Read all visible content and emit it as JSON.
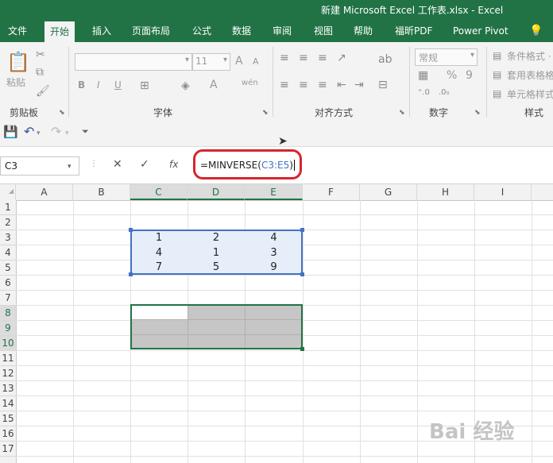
{
  "window": {
    "title": "新建 Microsoft Excel 工作表.xlsx  -  Excel"
  },
  "ribbon": {
    "tabs": [
      "文件",
      "开始",
      "插入",
      "页面布局",
      "公式",
      "数据",
      "审阅",
      "视图",
      "帮助",
      "福昕PDF",
      "Power Pivot"
    ],
    "active_tab": "开始",
    "groups": {
      "clipboard": {
        "label": "剪贴板",
        "paste_label": "粘贴"
      },
      "font": {
        "label": "字体",
        "font_size": "11",
        "bold": "B",
        "italic": "I",
        "underline": "U",
        "grow": "A",
        "shrink": "A",
        "font_color": "A",
        "wen": "wén"
      },
      "alignment": {
        "label": "对齐方式"
      },
      "number": {
        "label": "数字",
        "format": "常规",
        "percent": "%",
        "comma": "9"
      },
      "styles": {
        "label": "样式",
        "items": [
          "条件格式 ·",
          "套用表格格",
          "单元格样式"
        ]
      }
    }
  },
  "formula_bar": {
    "name_box": "C3",
    "cancel": "✕",
    "enter": "✓",
    "fx": "fx",
    "formula_prefix": "=MINVERSE(",
    "formula_ref": "C3:E5",
    "formula_suffix": ")"
  },
  "grid": {
    "columns": [
      "A",
      "B",
      "C",
      "D",
      "E",
      "F",
      "G",
      "H",
      "I"
    ],
    "rows": [
      "1",
      "2",
      "3",
      "4",
      "5",
      "6",
      "7",
      "8",
      "9",
      "10",
      "11",
      "12",
      "13",
      "14",
      "15",
      "16",
      "17"
    ],
    "matrix": [
      [
        "1",
        "2",
        "4"
      ],
      [
        "4",
        "1",
        "3"
      ],
      [
        "7",
        "5",
        "9"
      ]
    ]
  },
  "colors": {
    "accent": "#217346",
    "ref_blue": "#4472c4",
    "callout_red": "#d4262d"
  },
  "watermark": "Bai 经验"
}
